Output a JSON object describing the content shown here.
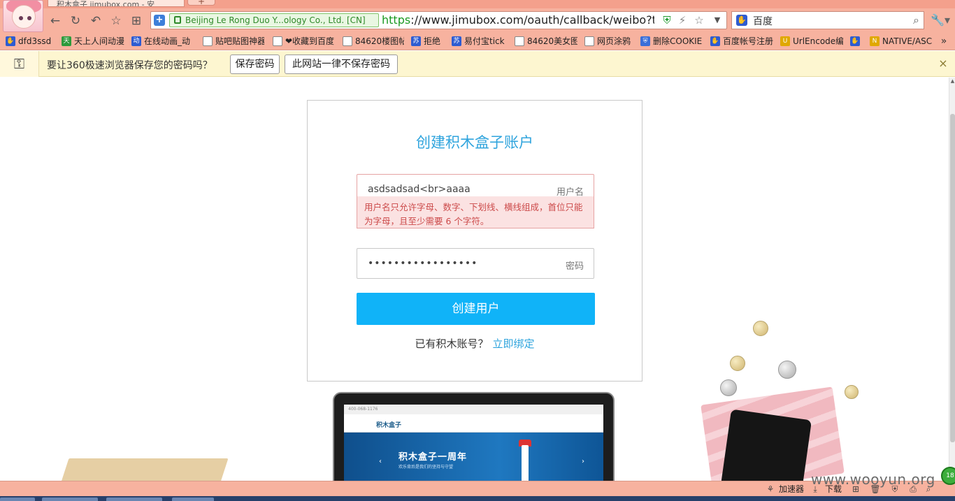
{
  "browser": {
    "tab_title": "积木盒子 jimubox.com - 安",
    "tab_new_label": "+",
    "cert_label": "Beijing Le Rong Duo Y...ology Co., Ltd. [CN]",
    "url_scheme": "https",
    "url_rest": "://www.jimubox.com/oauth/callback/weibo?type=",
    "search_engine": "百度",
    "nav_icons": [
      "back-icon",
      "refresh-icon",
      "undo-icon",
      "star-icon",
      "grid-icon"
    ]
  },
  "bookmarks": [
    {
      "label": "dfd3ssd",
      "icon": "paw"
    },
    {
      "label": "天上人间动漫",
      "icon": "tian"
    },
    {
      "label": "在线动画_动",
      "icon": "zhi"
    },
    {
      "label": "贴吧贴图神器",
      "icon": "doc"
    },
    {
      "label": "❤收藏到百度",
      "icon": "doc"
    },
    {
      "label": "84620楼图帖",
      "icon": "doc"
    },
    {
      "label": "拒绝",
      "icon": "zhi"
    },
    {
      "label": "易付宝tick",
      "icon": "zhi"
    },
    {
      "label": "84620美女图",
      "icon": "doc"
    },
    {
      "label": "网页涂鸦",
      "icon": "doc"
    },
    {
      "label": "删除COOKIE",
      "icon": "sh"
    },
    {
      "label": "百度帐号注册",
      "icon": "paw"
    },
    {
      "label": "UrlEncode编",
      "icon": "ue"
    },
    {
      "label": "",
      "icon": "paw"
    },
    {
      "label": "NATIVE/ASC",
      "icon": "ue"
    }
  ],
  "bookmarks_more": "»",
  "password_bar": {
    "message": "要让360极速浏览器保存您的密码吗？",
    "save_label": "保存密码",
    "never_label": "此网站一律不保存密码",
    "close": "×"
  },
  "form": {
    "title": "创建积木盒子账户",
    "username_value": "asdsadsad<br>aaaa",
    "username_placeholder": "用户名",
    "username_error": "用户名只允许字母、数字、下划线、横线组成，首位只能为字母，且至少需要 6 个字符。",
    "password_value": "•••••••••••••••••",
    "password_placeholder": "密码",
    "submit_label": "创建用户",
    "has_account_text": "已有积木账号？",
    "bind_link": "立即绑定"
  },
  "laptop_screen": {
    "phone": "400-068-1176",
    "logo": "积木盒子",
    "banner_title": "积木盒子一周年",
    "banner_sub": "欢乐背后是我们的坚持与守望"
  },
  "statusbar": {
    "accelerator": "加速器",
    "download": "下载",
    "watermark": "www.wooyun.org",
    "ball_label": "18"
  }
}
